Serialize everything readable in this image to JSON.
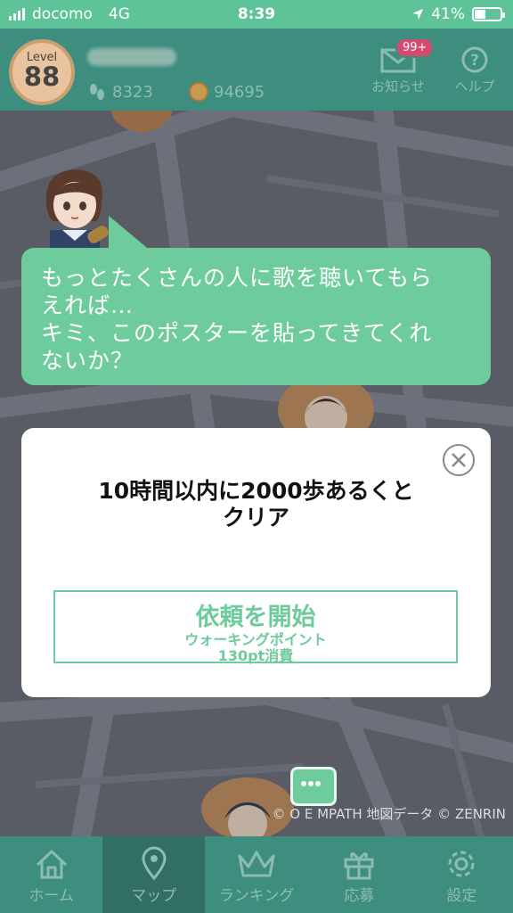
{
  "status_bar": {
    "carrier": "docomo",
    "network": "4G",
    "time": "8:39",
    "battery": "41%"
  },
  "header": {
    "level_label": "Level",
    "level": "88",
    "steps": "8323",
    "coins": "94695",
    "notifications_label": "お知らせ",
    "notifications_badge": "99+",
    "help_label": "ヘルプ"
  },
  "speech": {
    "lines": [
      "もっとたくさんの人に歌を聴いてもら",
      "えれば…",
      "キミ、このポスターを貼ってきてくれ",
      "ないか？"
    ]
  },
  "modal": {
    "title_line1": "10時間以内に2000歩あるくと",
    "title_line2": "クリア",
    "start_label": "依頼を開始",
    "cost_line1": "ウォーキングポイント",
    "cost_line2": "130pt消費"
  },
  "map": {
    "credits": "© O    E    MPATH 地図データ © ZENRIN"
  },
  "nav": {
    "items": [
      {
        "label": "ホーム",
        "icon": "home-icon"
      },
      {
        "label": "マップ",
        "icon": "map-pin-icon"
      },
      {
        "label": "ランキング",
        "icon": "crown-icon"
      },
      {
        "label": "応募",
        "icon": "gift-icon"
      },
      {
        "label": "設定",
        "icon": "gear-icon"
      }
    ],
    "active": "マップ"
  },
  "colors": {
    "accent": "#6ecb9b",
    "header": "#3d8e7f",
    "map": "#6b6e76"
  }
}
